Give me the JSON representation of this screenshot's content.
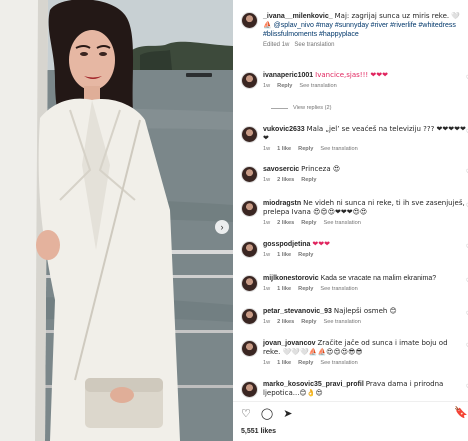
{
  "caption": {
    "username": "_ivana__milenkovic_",
    "text": "Maj: zagrijaj sunca uz miris reke. 🤍⛵",
    "mention": "@splav_nivo",
    "hashtags": "#may #sunnyday #river #riverlife #whitedress #blissfulmoments #happyplace",
    "edited": "Edited",
    "time": "1w",
    "see_translation": "See translation"
  },
  "comments": [
    {
      "user": "ivanaperic1001",
      "text": "Ivancice,sjas!!! ❤❤❤",
      "time": "1w",
      "likes": "",
      "reply": "Reply",
      "translate": "See translation",
      "view_replies": "View replies (2)"
    },
    {
      "user": "vukovic2633",
      "text": "Mala „jel’ se veaćeš na televiziju ??? ❤❤❤❤❤ ❤",
      "time": "1w",
      "likes": "1 like",
      "reply": "Reply",
      "translate": "See translation"
    },
    {
      "user": "savosercic",
      "text": "Princeza 😍",
      "time": "1w",
      "likes": "2 likes",
      "reply": "Reply",
      "translate": ""
    },
    {
      "user": "miodragstn",
      "text": "Ne videh ni sunca ni reke, ti ih sve zasenjuješ, prelepa Ivana 😍😍😍❤❤❤😍😍",
      "time": "1w",
      "likes": "2 likes",
      "reply": "Reply",
      "translate": "See translation"
    },
    {
      "user": "gosspodjetina",
      "text": "❤❤❤",
      "time": "1w",
      "likes": "1 like",
      "reply": "Reply",
      "translate": ""
    },
    {
      "user": "mijlkonestorovic",
      "text": "Kada se vracate na malim ekranima?",
      "time": "1w",
      "likes": "1 like",
      "reply": "Reply",
      "translate": "See translation"
    },
    {
      "user": "petar_stevanovic_93",
      "text": "Najlepši osmeh 😊",
      "time": "1w",
      "likes": "2 likes",
      "reply": "Reply",
      "translate": "See translation"
    },
    {
      "user": "jovan_jovancov",
      "text": "Zračite jače od sunca i imate boju od reke. 🤍🤍🤍⛵⛵😍😍😍😎😎",
      "time": "1w",
      "likes": "1 like",
      "reply": "Reply",
      "translate": "See translation"
    },
    {
      "user": "marko_kosovic35_pravi_profil",
      "text": "Prava dama i prirodna ljepotica...😊👌😍",
      "time": "",
      "likes": "",
      "reply": "",
      "translate": ""
    }
  ],
  "likes_count": "5,551 likes",
  "icons": {
    "like": "heart-icon",
    "comment": "comment-icon",
    "share": "send-icon",
    "save": "bookmark-icon",
    "next": "chevron-right-icon"
  }
}
